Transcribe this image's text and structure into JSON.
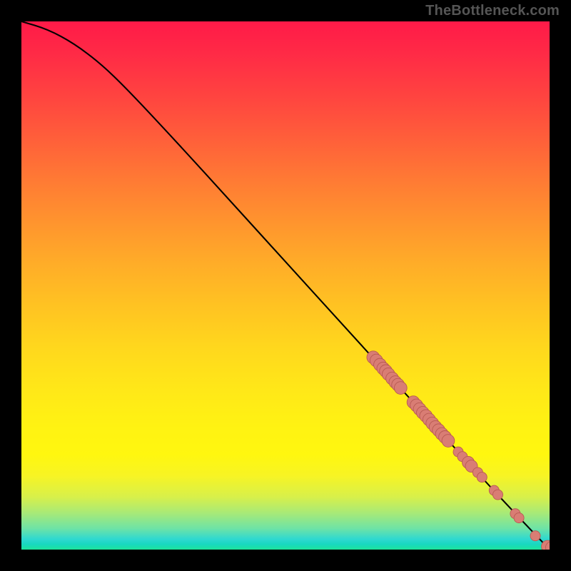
{
  "watermark": "TheBottleneck.com",
  "colors": {
    "curve": "#000000",
    "point_fill": "#d97d74",
    "point_stroke": "#b85a52",
    "background_frame": "#000000"
  },
  "chart_data": {
    "type": "scatter",
    "title": "",
    "xlabel": "",
    "ylabel": "",
    "xlim": [
      0,
      100
    ],
    "ylim": [
      0,
      100
    ],
    "curve": {
      "description": "Monotone decreasing curve; slightly convex near the top-left corner then roughly linear to bottom-right",
      "points": [
        {
          "x": 0,
          "y": 100
        },
        {
          "x": 5,
          "y": 98.5
        },
        {
          "x": 10,
          "y": 95.8
        },
        {
          "x": 15,
          "y": 92.0
        },
        {
          "x": 20,
          "y": 87.2
        },
        {
          "x": 30,
          "y": 76.5
        },
        {
          "x": 40,
          "y": 65.5
        },
        {
          "x": 50,
          "y": 54.5
        },
        {
          "x": 60,
          "y": 43.5
        },
        {
          "x": 70,
          "y": 32.5
        },
        {
          "x": 80,
          "y": 21.5
        },
        {
          "x": 90,
          "y": 10.5
        },
        {
          "x": 100,
          "y": 0
        }
      ]
    },
    "series": [
      {
        "name": "data-points",
        "marker": "circle",
        "values": [
          {
            "x": 66.6,
            "y": 36.4,
            "r": 1.2
          },
          {
            "x": 67.2,
            "y": 35.8,
            "r": 1.2
          },
          {
            "x": 67.9,
            "y": 35.0,
            "r": 1.2
          },
          {
            "x": 68.5,
            "y": 34.3,
            "r": 1.2
          },
          {
            "x": 69.0,
            "y": 33.8,
            "r": 1.2
          },
          {
            "x": 69.5,
            "y": 33.2,
            "r": 1.2
          },
          {
            "x": 70.2,
            "y": 32.4,
            "r": 1.2
          },
          {
            "x": 70.8,
            "y": 31.7,
            "r": 1.2
          },
          {
            "x": 71.3,
            "y": 31.2,
            "r": 1.2
          },
          {
            "x": 71.8,
            "y": 30.6,
            "r": 1.2
          },
          {
            "x": 74.2,
            "y": 27.9,
            "r": 1.2
          },
          {
            "x": 74.8,
            "y": 27.3,
            "r": 1.2
          },
          {
            "x": 75.4,
            "y": 26.6,
            "r": 1.2
          },
          {
            "x": 76.0,
            "y": 25.9,
            "r": 1.2
          },
          {
            "x": 76.6,
            "y": 25.3,
            "r": 1.2
          },
          {
            "x": 77.2,
            "y": 24.6,
            "r": 1.2
          },
          {
            "x": 77.8,
            "y": 23.9,
            "r": 1.2
          },
          {
            "x": 78.4,
            "y": 23.2,
            "r": 1.2
          },
          {
            "x": 79.0,
            "y": 22.6,
            "r": 1.2
          },
          {
            "x": 79.6,
            "y": 21.9,
            "r": 1.2
          },
          {
            "x": 80.2,
            "y": 21.3,
            "r": 1.2
          },
          {
            "x": 80.8,
            "y": 20.6,
            "r": 1.2
          },
          {
            "x": 82.7,
            "y": 18.5,
            "r": 0.95
          },
          {
            "x": 83.5,
            "y": 17.6,
            "r": 0.95
          },
          {
            "x": 84.6,
            "y": 16.5,
            "r": 1.15
          },
          {
            "x": 85.2,
            "y": 15.8,
            "r": 1.15
          },
          {
            "x": 86.4,
            "y": 14.6,
            "r": 0.95
          },
          {
            "x": 87.2,
            "y": 13.7,
            "r": 0.95
          },
          {
            "x": 89.5,
            "y": 11.2,
            "r": 0.95
          },
          {
            "x": 90.2,
            "y": 10.4,
            "r": 0.95
          },
          {
            "x": 93.5,
            "y": 6.8,
            "r": 0.95
          },
          {
            "x": 94.2,
            "y": 6.0,
            "r": 0.95
          },
          {
            "x": 97.3,
            "y": 2.6,
            "r": 0.95
          },
          {
            "x": 99.6,
            "y": 0.6,
            "r": 1.15
          },
          {
            "x": 100.4,
            "y": 0.4,
            "r": 1.15
          }
        ]
      }
    ]
  }
}
